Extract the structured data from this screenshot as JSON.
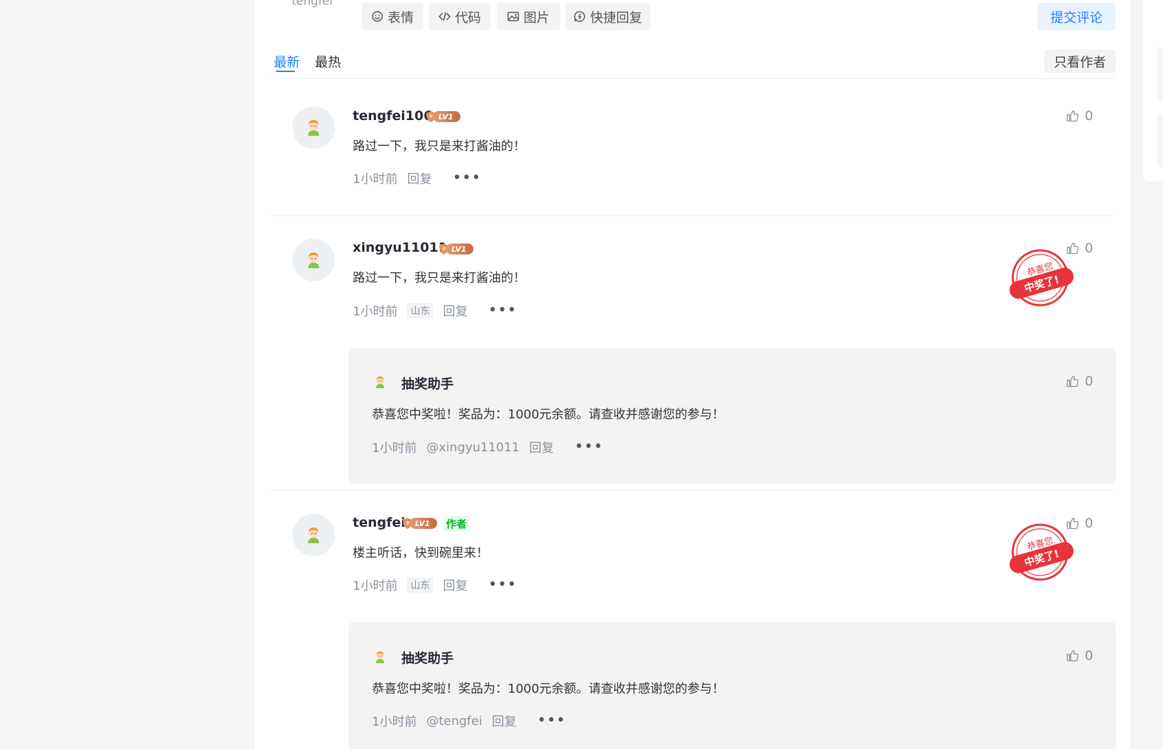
{
  "composer": {
    "prev_user": "tengfei",
    "emoji_label": "表情",
    "code_label": "代码",
    "image_label": "图片",
    "quick_reply_label": "快捷回复",
    "submit_label": "提交评论"
  },
  "tabs": {
    "latest": "最新",
    "hottest": "最热",
    "author_only": "只看作者"
  },
  "comments": [
    {
      "user": "tengfei106",
      "level": "LV1",
      "text": "路过一下，我只是来打酱油的！",
      "time": "1小时前",
      "reply": "回复",
      "likes": "0"
    },
    {
      "user": "xingyu11011",
      "level": "LV1",
      "text": "路过一下，我只是来打酱油的！",
      "time": "1小时前",
      "region": "山东",
      "reply": "回复",
      "likes": "0",
      "stamp": {
        "top": "恭喜您",
        "bottom": "中奖了!"
      },
      "sub": {
        "user": "抽奖助手",
        "text": "恭喜您中奖啦！奖品为：1000元余额。请查收并感谢您的参与！",
        "time": "1小时前",
        "mention": "@xingyu11011",
        "reply": "回复",
        "likes": "0"
      }
    },
    {
      "user": "tengfei",
      "level": "LV1",
      "author_tag": "作者",
      "text": "楼主听话，快到碗里来！",
      "time": "1小时前",
      "region": "山东",
      "reply": "回复",
      "likes": "0",
      "stamp": {
        "top": "恭喜您",
        "bottom": "中奖了!"
      },
      "sub": {
        "user": "抽奖助手",
        "text": "恭喜您中奖啦！奖品为：1000元余额。请查收并感谢您的参与！",
        "time": "1小时前",
        "mention": "@tengfei",
        "reply": "回复",
        "likes": "0"
      }
    }
  ],
  "colors": {
    "accent": "#1e80ff",
    "author_green": "#00b42a",
    "stamp_red": "#e8323c"
  }
}
